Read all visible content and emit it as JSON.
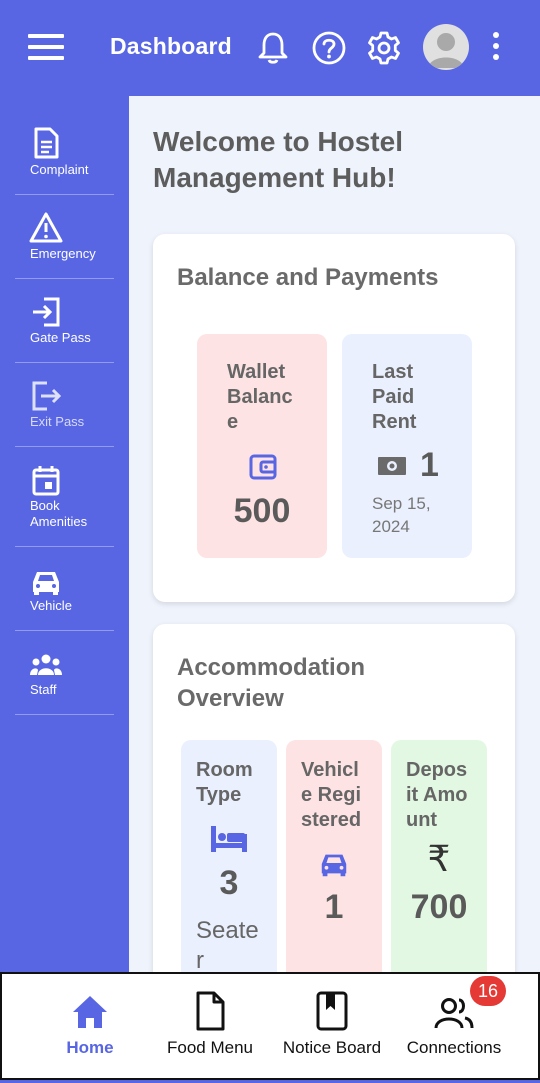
{
  "header": {
    "title": "Dashboard",
    "icons": [
      "menu-icon",
      "bell-icon",
      "help-icon",
      "gear-icon",
      "avatar",
      "more-vertical-icon"
    ]
  },
  "sidebar": {
    "items": [
      {
        "label": "Complaint",
        "icon": "document-icon"
      },
      {
        "label": "Emergency",
        "icon": "warning-icon"
      },
      {
        "label": "Gate Pass",
        "icon": "enter-icon"
      },
      {
        "label": "Exit Pass",
        "icon": "exit-icon"
      },
      {
        "label": "Book Amenities",
        "icon": "calendar-icon"
      },
      {
        "label": "Vehicle",
        "icon": "car-icon"
      },
      {
        "label": "Staff",
        "icon": "group-icon"
      }
    ]
  },
  "main": {
    "welcome": "Welcome to Hostel Management Hub!",
    "balance_card": {
      "title": "Balance and Payments",
      "wallet": {
        "label": "Wallet Balance",
        "value": "500",
        "icon": "wallet-icon"
      },
      "last_rent": {
        "label": "Last Paid Rent",
        "value": "1",
        "date": "Sep 15, 2024",
        "icon": "money-icon"
      }
    },
    "accommodation_card": {
      "title": "Accommodation Overview",
      "room": {
        "label": "Room Type",
        "value": "3",
        "sub": "Seater",
        "icon": "bed-icon"
      },
      "vehicle": {
        "label": "Vehicle Registered",
        "value": "1",
        "icon": "car-icon"
      },
      "deposit": {
        "label": "Deposit Amount",
        "value": "700",
        "icon": "rupee-icon"
      }
    }
  },
  "bottom_nav": {
    "items": [
      {
        "label": "Home",
        "icon": "home-icon",
        "active": true
      },
      {
        "label": "Food Menu",
        "icon": "file-icon"
      },
      {
        "label": "Notice Board",
        "icon": "book-icon"
      },
      {
        "label": "Connections",
        "icon": "people-icon",
        "badge": "16"
      }
    ]
  },
  "colors": {
    "primary": "#5866e3",
    "background": "#eff3fc",
    "pink_tile": "#fde3e3",
    "blue_tile": "#eaf0fd",
    "green_tile": "#e2f8e2",
    "badge": "#e53935"
  }
}
